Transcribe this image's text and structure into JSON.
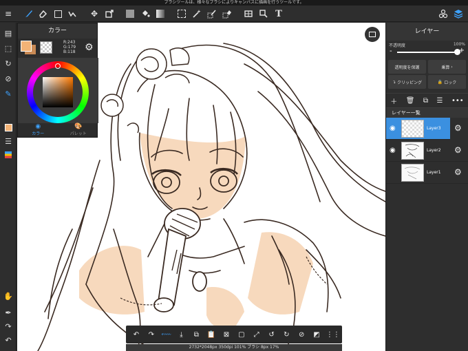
{
  "tip": "ブラシツールは、様々なブラシによりキャンバスに描画を行うツールです。",
  "toolbar": {
    "items": [
      "menu",
      "brush",
      "eraser",
      "rectangle",
      "transform",
      "move",
      "fill-color",
      "bucket",
      "gradient",
      "select",
      "magic-wand",
      "select-pen",
      "select-eraser",
      "snap",
      "crop",
      "text"
    ],
    "right_icons": [
      "materials-icon",
      "layers-icon"
    ]
  },
  "color_panel": {
    "title": "カラー",
    "r": "R:243",
    "g": "G:179",
    "b": "B:118",
    "main_color": "#f3b376",
    "tabs": [
      "カラー",
      "パレット"
    ]
  },
  "layer_panel": {
    "title": "レイヤー",
    "opacity_label": "不透明度",
    "opacity_value": "100%",
    "opacity": 1.0,
    "protect_label": "透明度を保護",
    "blend_label": "乗算",
    "clipping_label": "クリッピング",
    "lock_label": "ロック",
    "section_label": "レイヤー一覧",
    "layers": [
      {
        "name": "Layer3",
        "selected": true,
        "visible": true
      },
      {
        "name": "Layer2",
        "selected": false,
        "visible": true
      },
      {
        "name": "Layer1",
        "selected": false,
        "visible": false
      }
    ]
  },
  "status": "2732*2048px 350dpi 101% ブラシ 8px 17%",
  "colors": {
    "accent": "#3ea3ff",
    "selected_layer": "#3b90e0",
    "skin": "#f3b376"
  }
}
